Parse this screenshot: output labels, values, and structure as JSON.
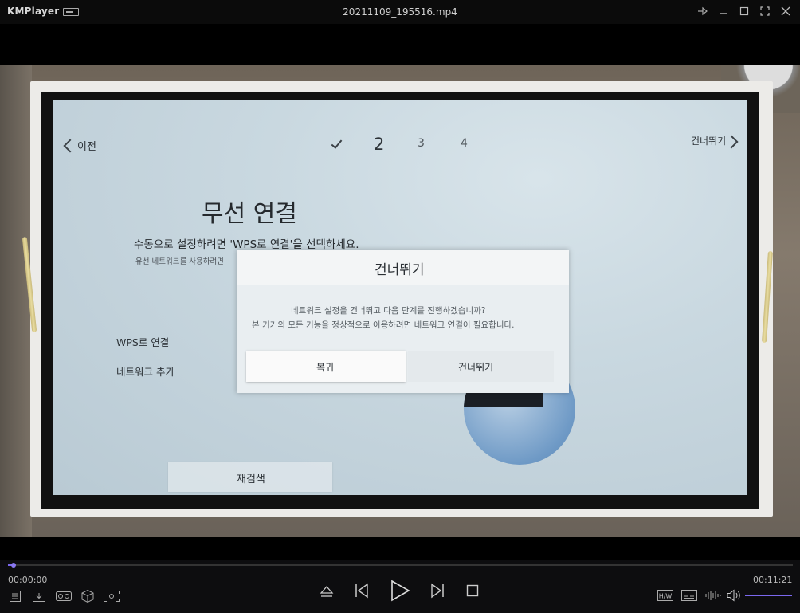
{
  "titlebar": {
    "app_name": "KMPlayer",
    "file_name": "20211109_195516.mp4"
  },
  "tv": {
    "back_label": "이전",
    "steps": [
      "2",
      "3",
      "4"
    ],
    "skip_label": "건너뛰기",
    "heading": "무선 연결",
    "subheading": "수동으로 설정하려면 'WPS로 연결'을 선택하세요.",
    "subtext": "유선 네트워크를 사용하려면",
    "menu": [
      "WPS로 연결",
      "네트워크 추가"
    ],
    "rescan_label": "재검색"
  },
  "dialog": {
    "title": "건너뛰기",
    "message_line1": "네트워크 설정을 건너뛰고 다음 단계를 진행하겠습니까?",
    "message_line2": "본 기기의 모든 기능을 정상적으로 이용하려면 네트워크 연결이 필요합니다.",
    "primary_label": "복귀",
    "secondary_label": "건너뛰기"
  },
  "controls": {
    "current_time": "00:00:00",
    "total_time": "00:11:21",
    "progress_fraction": 0.007,
    "volume_fraction": 1.0,
    "hw_label": "H/W",
    "accent_color": "#7b68ee"
  }
}
